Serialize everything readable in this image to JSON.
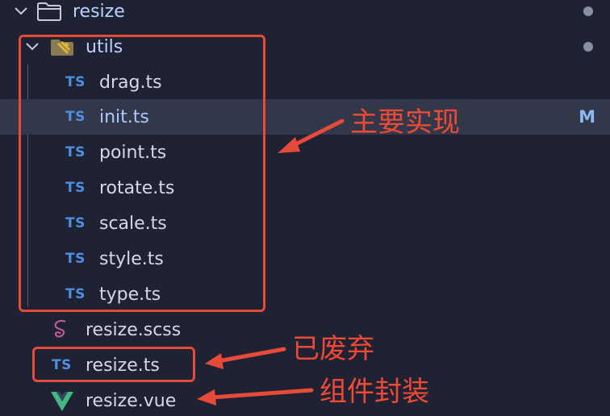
{
  "explorer": {
    "root_folder": {
      "label": "resize"
    },
    "utils_folder": {
      "label": "utils"
    },
    "utils_files": [
      {
        "icon": "TS",
        "label": "drag.ts"
      },
      {
        "icon": "TS",
        "label": "init.ts",
        "badge": "M"
      },
      {
        "icon": "TS",
        "label": "point.ts"
      },
      {
        "icon": "TS",
        "label": "rotate.ts"
      },
      {
        "icon": "TS",
        "label": "scale.ts"
      },
      {
        "icon": "TS",
        "label": "style.ts"
      },
      {
        "icon": "TS",
        "label": "type.ts"
      }
    ],
    "root_files": [
      {
        "icon": "sass-icon",
        "label": "resize.scss"
      },
      {
        "icon": "TS",
        "label": "resize.ts"
      },
      {
        "icon": "vue-icon",
        "label": "resize.vue"
      }
    ]
  },
  "annotations": {
    "main_impl": "主要实现",
    "deprecated": "已废弃",
    "component_wrapper": "组件封装",
    "color": "#e84a3a"
  }
}
